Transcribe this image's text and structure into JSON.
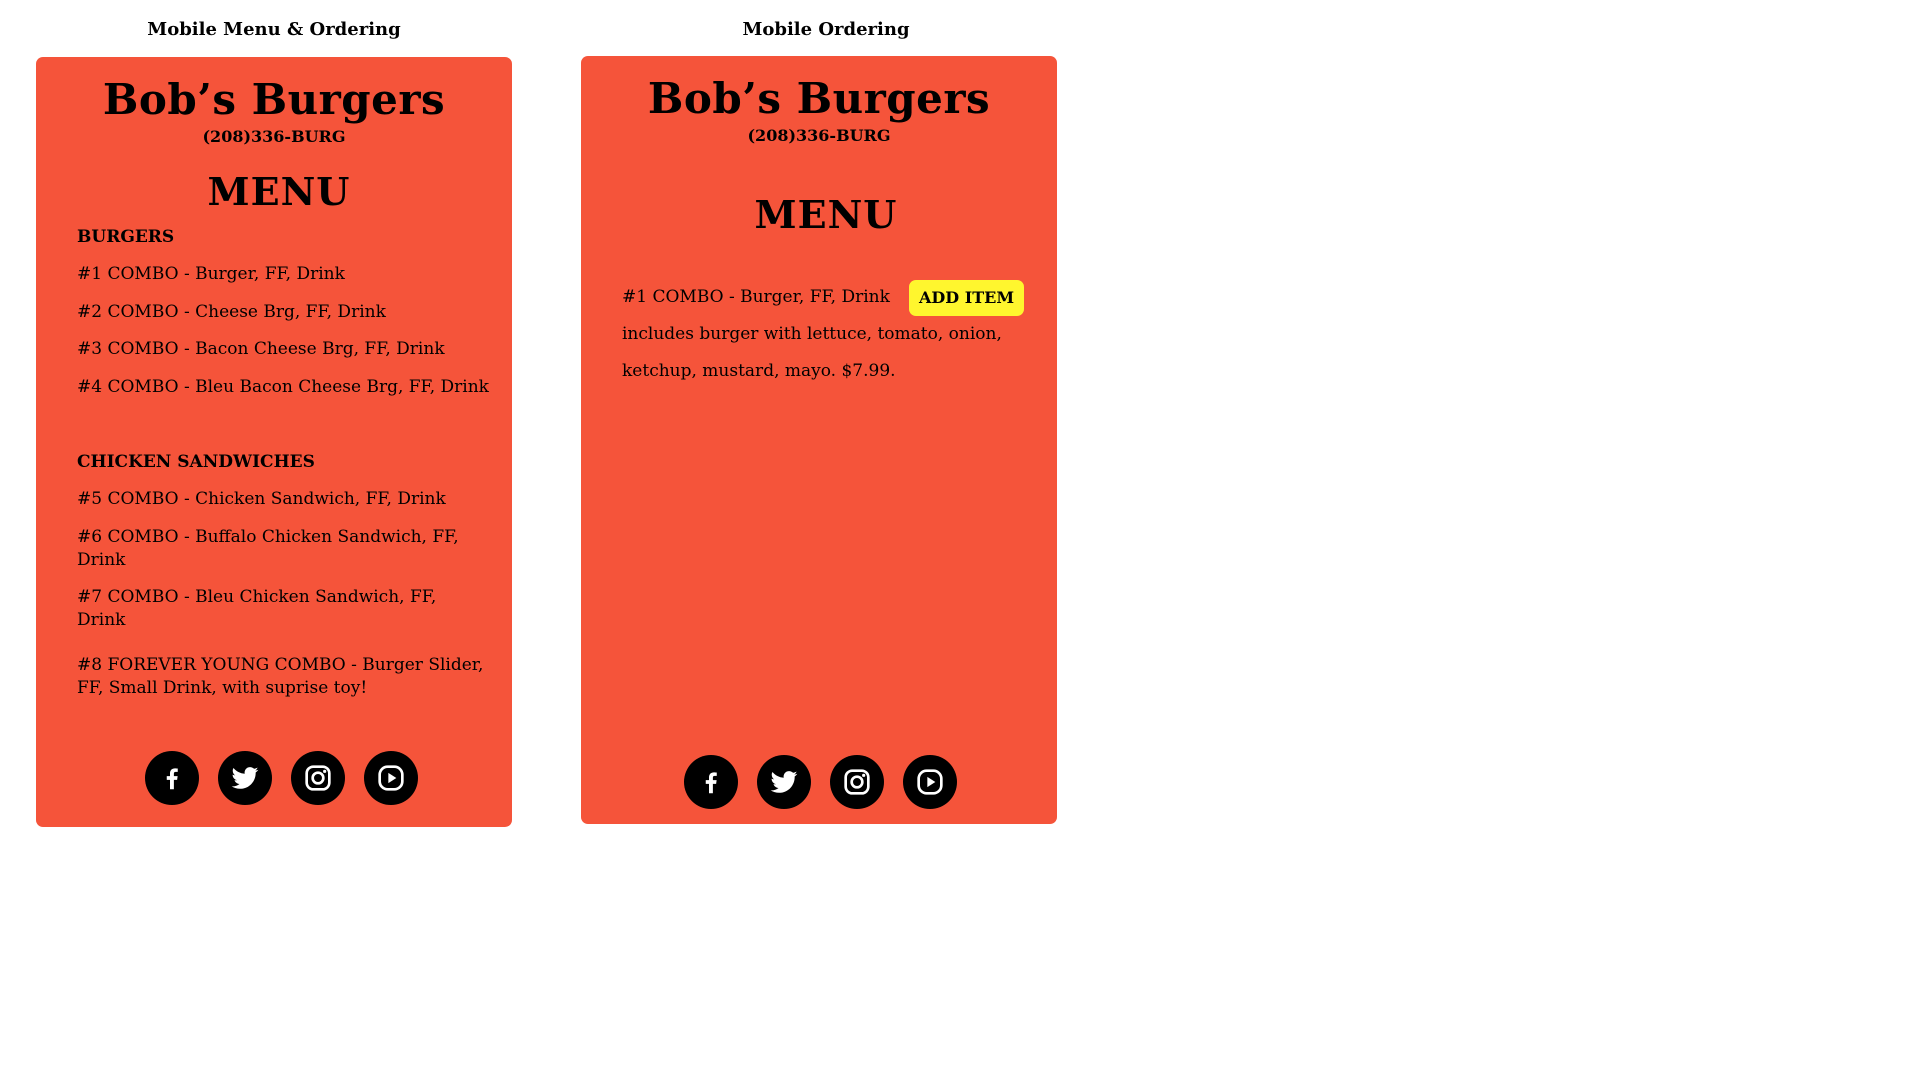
{
  "left_panel": {
    "label": "Mobile Menu & Ordering",
    "title": "Bob’s Burgers",
    "phone": "(208)336-BURG",
    "menu_heading": "MENU",
    "sections": [
      {
        "heading": "BURGERS",
        "items": [
          "#1 COMBO - Burger, FF, Drink",
          "#2 COMBO - Cheese Brg, FF, Drink",
          "#3 COMBO - Bacon Cheese Brg, FF, Drink",
          "#4 COMBO - Bleu Bacon Cheese Brg, FF, Drink"
        ]
      },
      {
        "heading": "CHICKEN SANDWICHES",
        "items": [
          "#5 COMBO - Chicken Sandwich, FF, Drink",
          "#6 COMBO - Buffalo Chicken Sandwich, FF, Drink",
          "#7 COMBO - Bleu Chicken Sandwich, FF, Drink",
          "#8 FOREVER YOUNG COMBO - Burger Slider, FF, Small Drink, with suprise toy!"
        ]
      }
    ],
    "social": [
      "facebook-icon",
      "twitter-icon",
      "instagram-icon",
      "video-icon"
    ]
  },
  "right_panel": {
    "label": "Mobile Ordering",
    "title": "Bob’s Burgers",
    "phone": "(208)336-BURG",
    "menu_heading": "MENU",
    "item_name": "#1 COMBO - Burger, FF, Drink",
    "add_label": "ADD ITEM",
    "item_description": "includes burger with lettuce, tomato, onion, ketchup, mustard, mayo. $7.99.",
    "social": [
      "facebook-icon",
      "twitter-icon",
      "instagram-icon",
      "video-icon"
    ]
  },
  "colors": {
    "panel_bg": "#f5543a",
    "add_button_bg": "#fff62e",
    "icon_bg": "#000000"
  }
}
